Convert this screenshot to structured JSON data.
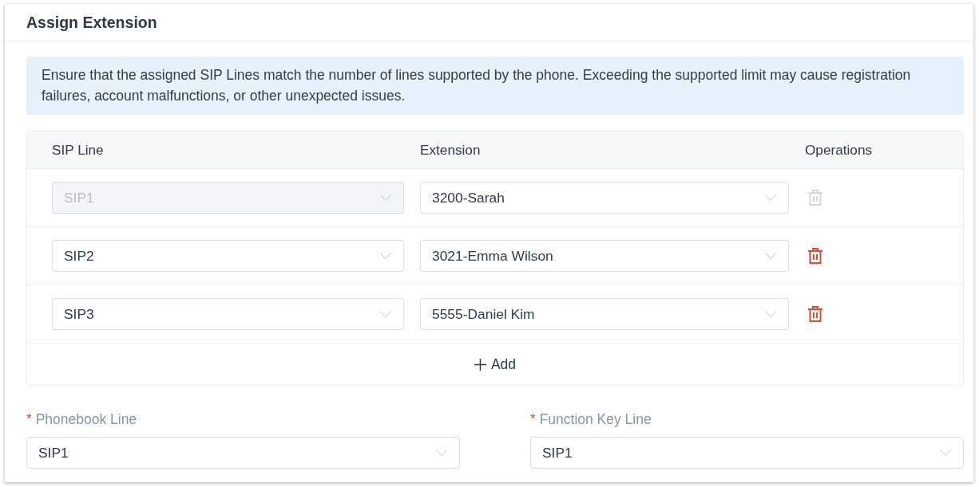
{
  "section": {
    "title": "Assign Extension"
  },
  "notice": {
    "text": "Ensure that the assigned SIP Lines match the number of lines supported by the phone. Exceeding the supported limit may cause registration failures, account malfunctions, or other unexpected issues."
  },
  "table": {
    "columns": [
      "SIP Line",
      "Extension",
      "Operations"
    ],
    "rows": [
      {
        "sip_line": "SIP1",
        "sip_line_disabled": true,
        "extension": "3200-Sarah",
        "delete_disabled": true
      },
      {
        "sip_line": "SIP2",
        "sip_line_disabled": false,
        "extension": "3021-Emma Wilson",
        "delete_disabled": false
      },
      {
        "sip_line": "SIP3",
        "sip_line_disabled": false,
        "extension": "5555-Daniel Kim",
        "delete_disabled": false
      }
    ],
    "add_button": "Add"
  },
  "fields": [
    {
      "required_mark": "*",
      "label": "Phonebook Line",
      "value": "SIP1"
    },
    {
      "required_mark": "*",
      "label": "Function Key Line",
      "value": "SIP1"
    }
  ]
}
